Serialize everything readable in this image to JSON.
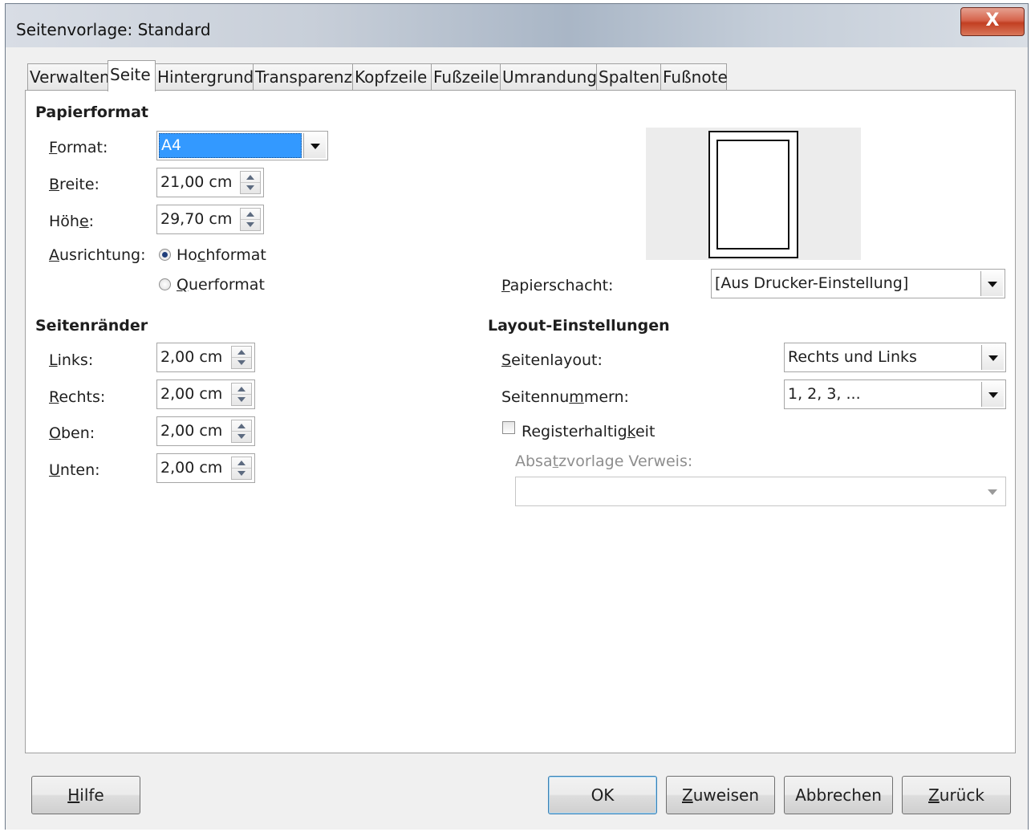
{
  "window": {
    "title": "Seitenvorlage: Standard",
    "close_label": "X"
  },
  "tabs": [
    {
      "label": "Verwalten"
    },
    {
      "label": "Seite",
      "active": true
    },
    {
      "label": "Hintergrund"
    },
    {
      "label": "Transparenz"
    },
    {
      "label": "Kopfzeile"
    },
    {
      "label": "Fußzeile"
    },
    {
      "label": "Umrandung"
    },
    {
      "label": "Spalten"
    },
    {
      "label": "Fußnote"
    }
  ],
  "papierformat": {
    "heading": "Papierformat",
    "format": {
      "acc": "F",
      "rest": "ormat:",
      "value": "A4"
    },
    "breite": {
      "acc": "B",
      "rest": "reite:",
      "value": "21,00 cm"
    },
    "hoehe": {
      "pre": "Höh",
      "acc": "e",
      "rest": ":",
      "value": "29,70 cm"
    },
    "ausrichtung": {
      "acc": "A",
      "rest": "usrichtung:"
    },
    "hochformat": {
      "pre": "Ho",
      "acc": "c",
      "rest": "hformat",
      "selected": true
    },
    "querformat": {
      "acc": "Q",
      "rest": "uerformat",
      "selected": false
    },
    "papierschacht": {
      "acc": "P",
      "rest": "apierschacht:",
      "value": "[Aus Drucker-Einstellung]"
    }
  },
  "seitenraender": {
    "heading": "Seitenränder",
    "links": {
      "acc": "L",
      "rest": "inks:",
      "value": "2,00 cm"
    },
    "rechts": {
      "acc": "R",
      "rest": "echts:",
      "value": "2,00 cm"
    },
    "oben": {
      "acc": "O",
      "rest": "ben:",
      "value": "2,00 cm"
    },
    "unten": {
      "acc": "U",
      "rest": "nten:",
      "value": "2,00 cm"
    }
  },
  "layout": {
    "heading": "Layout-Einstellungen",
    "seitenlayout": {
      "acc": "S",
      "rest": "eitenlayout:",
      "value": "Rechts und Links"
    },
    "seitennummern": {
      "pre": "Seitennu",
      "acc": "m",
      "rest": "mern:",
      "value": "1, 2, 3, ..."
    },
    "registerhaltigkeit": {
      "pre": "Registerhaltig",
      "acc": "k",
      "rest": "eit",
      "checked": false
    },
    "absatzvorlage": {
      "pre": "Absa",
      "acc": "t",
      "rest": "zvorlage Verweis:",
      "value": ""
    }
  },
  "buttons": {
    "hilfe": {
      "acc": "H",
      "rest": "ilfe"
    },
    "ok": "OK",
    "zuweisen": {
      "acc": "Z",
      "rest": "uweisen"
    },
    "abbrechen": "Abbrechen",
    "zurueck": {
      "acc": "Z",
      "rest": "urück"
    }
  },
  "colors": {
    "selection": "#3399ff",
    "close_button": "#c94428"
  }
}
